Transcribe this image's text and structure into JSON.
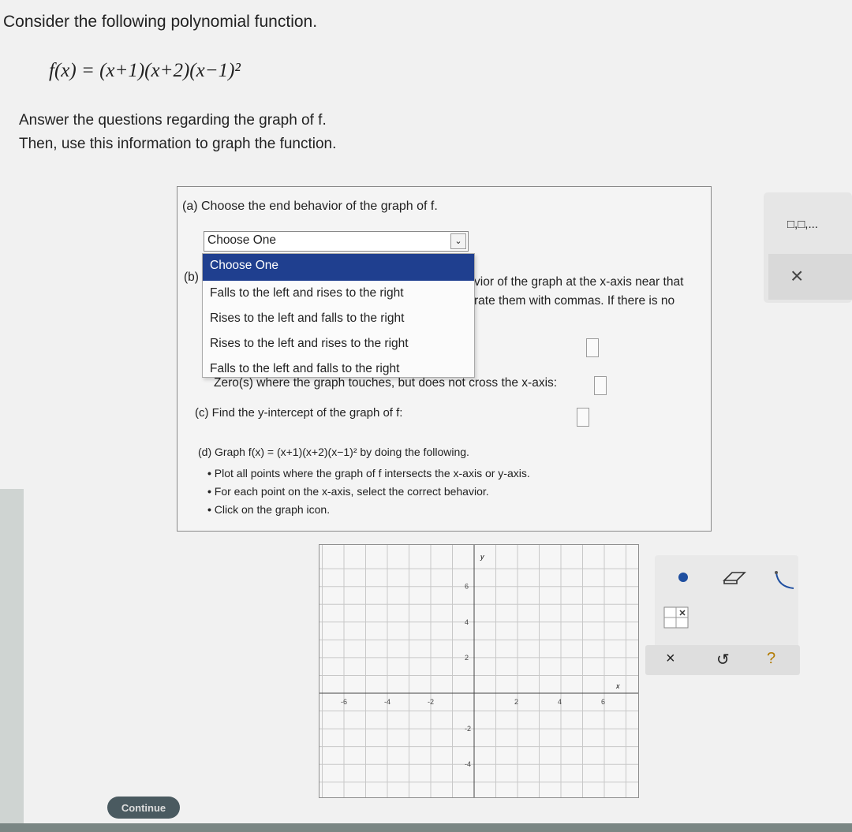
{
  "header": {
    "prompt": "Consider the following polynomial function.",
    "formula": "f(x) = (x+1)(x+2)(x−1)²",
    "instructions_line1": "Answer the questions regarding the graph of f.",
    "instructions_line2": "Then, use this information to graph the function."
  },
  "questions": {
    "part_a": "(a) Choose the end behavior of the graph of f.",
    "part_b_label": "(b)",
    "part_b_line1": "vior of the graph at the x-axis near that",
    "part_b_line2": "rate them with commas. If there is no",
    "part_b_touches": "Zero(s) where the graph touches, but does not cross the x-axis:",
    "part_c": "(c) Find the y-intercept of the graph of f:",
    "part_d": "(d) Graph f(x) = (x+1)(x+2)(x−1)² by doing the following.",
    "bullets": [
      "Plot all points where the graph of f intersects the x-axis or y-axis.",
      "For each point on the x-axis, select the correct behavior.",
      "Click on the graph icon."
    ]
  },
  "select": {
    "current": "Choose One",
    "options": [
      "Choose One",
      "Falls to the left and rises to the right",
      "Rises to the left and falls to the right",
      "Rises to the left and rises to the right",
      "Falls to the left and falls to the right"
    ]
  },
  "graph": {
    "x_ticks": [
      "-6",
      "-4",
      "-2",
      "2",
      "4",
      "6"
    ],
    "y_ticks": [
      "6",
      "4",
      "2",
      "-2",
      "-4"
    ],
    "x_label": "x",
    "y_label": "y"
  },
  "tools": {
    "point": "point-tool",
    "eraser": "eraser-tool",
    "curve": "curve-tool",
    "graph_icon": "graph-icon",
    "clear": "×",
    "undo": "↺",
    "help": "?"
  },
  "side_panel": {
    "boxes_label": "□,□,...",
    "close": "×"
  },
  "footer": {
    "continue": "Continue"
  },
  "colors": {
    "selected_option_bg": "#1f3f8f",
    "point_color": "#1f4fa0"
  }
}
